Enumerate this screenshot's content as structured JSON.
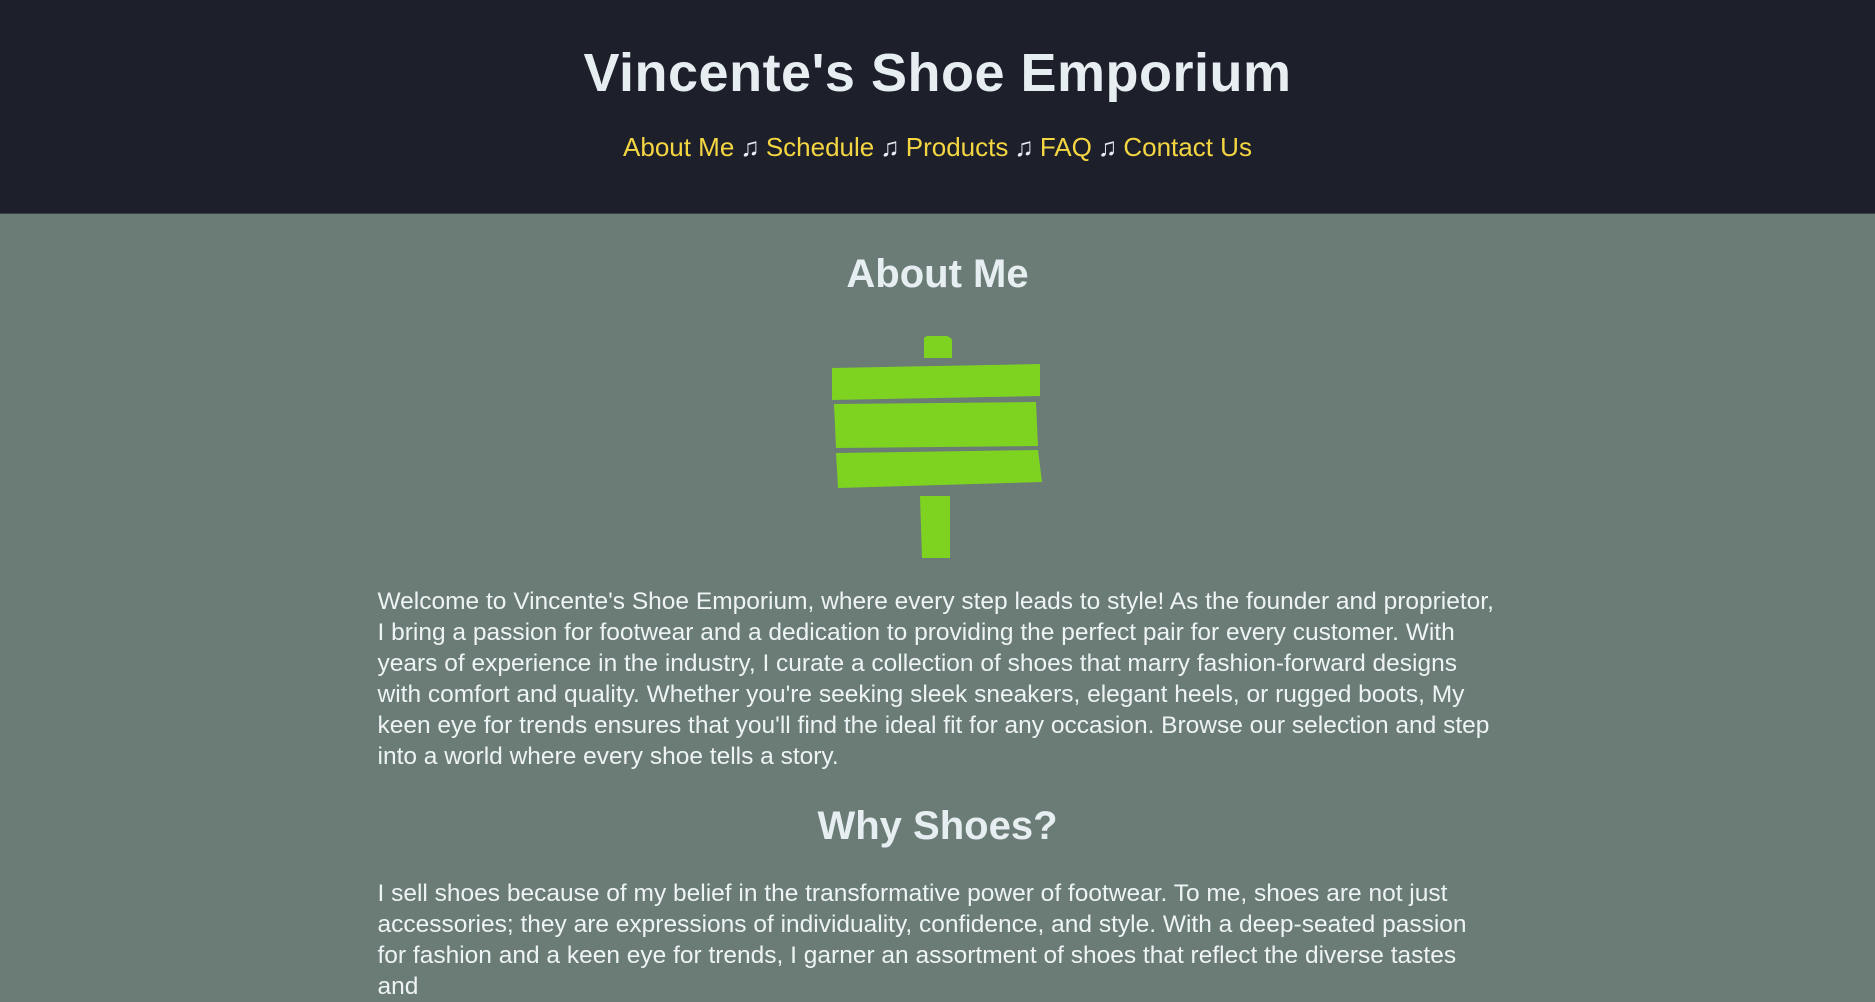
{
  "header": {
    "title": "Vincente's Shoe Emporium",
    "separator": "♫",
    "nav": [
      {
        "label": "About Me"
      },
      {
        "label": "Schedule"
      },
      {
        "label": "Products"
      },
      {
        "label": "FAQ"
      },
      {
        "label": "Contact Us"
      }
    ]
  },
  "about": {
    "heading": "About Me",
    "image_icon": "signpost-icon",
    "body": "Welcome to Vincente's Shoe Emporium, where every step leads to style! As the founder and proprietor, I bring a passion for footwear and a dedication to providing the perfect pair for every customer. With years of experience in the industry, I curate a collection of shoes that marry fashion-forward designs with comfort and quality. Whether you're seeking sleek sneakers, elegant heels, or rugged boots, My keen eye for trends ensures that you'll find the ideal fit for any occasion. Browse our selection and step into a world where every shoe tells a story."
  },
  "why": {
    "heading": "Why Shoes?",
    "body": "I sell shoes because of my belief in the transformative power of footwear. To me, shoes are not just accessories; they are expressions of individuality, confidence, and style. With a deep-seated passion for fashion and a keen eye for trends, I garner an assortment of shoes that reflect the diverse tastes and"
  },
  "colors": {
    "header_bg": "#1d1f2b",
    "page_bg": "#6a7c75",
    "nav_link": "#f4d642",
    "sign_green": "#7ed321"
  }
}
